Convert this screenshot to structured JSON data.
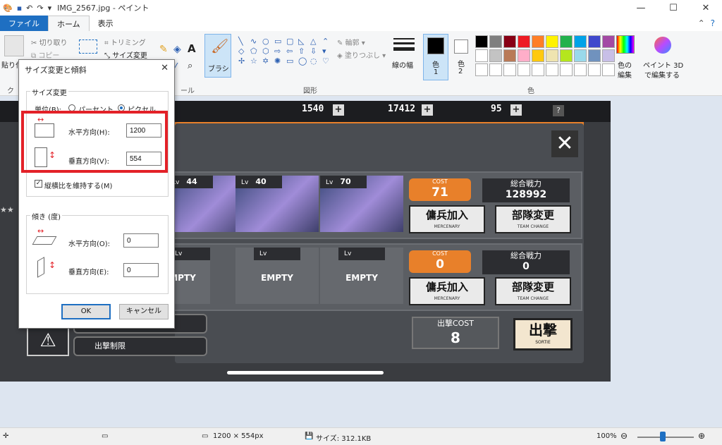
{
  "window": {
    "title": "IMG_2567.jpg - ペイント",
    "min": "—",
    "max": "☐",
    "close": "✕"
  },
  "tabs": {
    "file": "ファイル",
    "home": "ホーム",
    "view": "表示"
  },
  "ribbon": {
    "paste": "貼り付け",
    "cut": "切り取り",
    "copy": "コピー",
    "trim": "トリミング",
    "resize": "サイズ変更",
    "brush": "ブラシ",
    "outline": "輪郭",
    "fill": "塗りつぶし",
    "line_width": "線の幅",
    "color1": "色\n1",
    "color1_a": "色",
    "color1_b": "1",
    "color2_a": "色",
    "color2_b": "2",
    "edit_colors_a": "色の",
    "edit_colors_b": "編集",
    "paint3d_a": "ペイント 3D",
    "paint3d_b": "で編集する",
    "group_tools": "ール",
    "group_shapes": "図形",
    "group_colors": "色",
    "group_clip": "ク",
    "palette": [
      "#000000",
      "#7f7f7f",
      "#880015",
      "#ed1c24",
      "#ff7f27",
      "#fff200",
      "#22b14c",
      "#00a2e8",
      "#3f48cc",
      "#a349a4",
      "#ffffff",
      "#c3c3c3",
      "#b97a57",
      "#ffaec9",
      "#ffc90e",
      "#efe4b0",
      "#b5e61d",
      "#99d9ea",
      "#7092be",
      "#c8bfe7"
    ]
  },
  "dialog": {
    "title": "サイズ変更と傾斜",
    "resize_group": "サイズ変更",
    "unit_label": "単位(B):",
    "percent": "パーセント",
    "pixels": "ピクセル",
    "horizontal_label": "水平方向(H):",
    "horizontal_value": "1200",
    "vertical_label": "垂直方向(V):",
    "vertical_value": "554",
    "keep_ratio": "縦横比を維持する(M)",
    "skew_group": "傾き (度)",
    "skew_h_label": "水平方向(O):",
    "skew_h_value": "0",
    "skew_v_label": "垂直方向(E):",
    "skew_v_value": "0",
    "ok": "OK",
    "cancel": "キャンセル"
  },
  "game": {
    "res1": "1540",
    "res2": "17412",
    "res3": "95",
    "question": "?",
    "close": "✕",
    "row1": {
      "lv1": "44",
      "lv2": "40",
      "lv3": "70",
      "cost_label": "COST",
      "cost_value": "71",
      "power_label": "総合戦力",
      "power_value": "128992",
      "merc": "傭兵加入",
      "merc_sub": "MERCENARY",
      "team": "部隊変更",
      "team_sub": "TEAM CHANGE"
    },
    "row2": {
      "empty1": "MPTY",
      "empty2": "EMPTY",
      "empty3": "EMPTY",
      "cost_label": "COST",
      "cost_value": "0",
      "power_label": "総合戦力",
      "power_value": "0",
      "merc": "傭兵加入",
      "merc_sub": "MERCENARY",
      "team": "部隊変更",
      "team_sub": "TEAM CHANGE"
    },
    "lv_prefix": "Lv",
    "sortie_cost_label": "出撃COST",
    "sortie_cost_value": "8",
    "sortie": "出撃",
    "sortie_sub": "SORTIE",
    "limit": "出撃制限"
  },
  "status": {
    "dimensions": "1200 × 554px",
    "size": "サイズ: 312.1KB",
    "zoom": "100%"
  }
}
